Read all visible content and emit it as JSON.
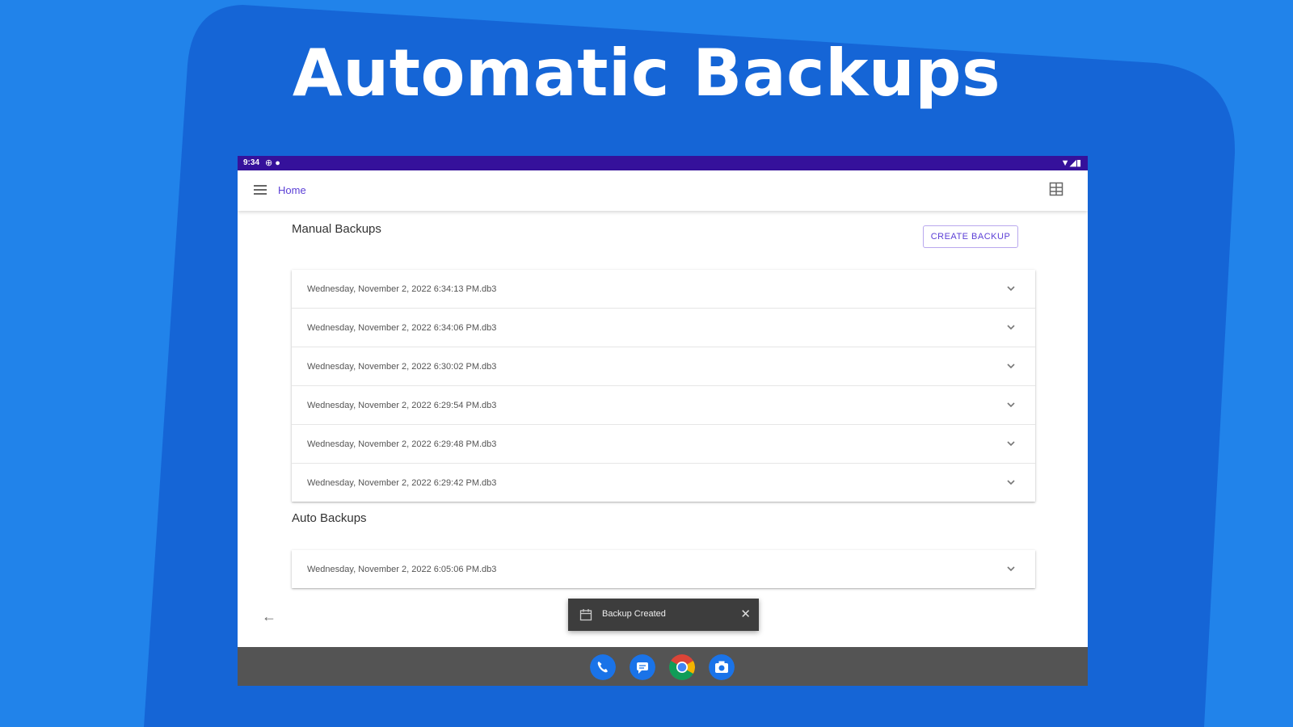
{
  "headline": "Automatic Backups",
  "status_bar": {
    "time": "9:34",
    "icons_left": "⊕ ●",
    "icons_right": "▼◢▮"
  },
  "app_bar": {
    "nav_label": "Home",
    "menu_icon": "menu-icon",
    "view_icon": "grid-view-icon"
  },
  "manual": {
    "title": "Manual Backups",
    "create_button": "CREATE BACKUP",
    "items": [
      "Wednesday, November 2, 2022 6:34:13 PM.db3",
      "Wednesday, November 2, 2022 6:34:06 PM.db3",
      "Wednesday, November 2, 2022 6:30:02 PM.db3",
      "Wednesday, November 2, 2022 6:29:54 PM.db3",
      "Wednesday, November 2, 2022 6:29:48 PM.db3",
      "Wednesday, November 2, 2022 6:29:42 PM.db3"
    ]
  },
  "auto": {
    "title": "Auto Backups",
    "items": [
      "Wednesday, November 2, 2022 6:05:06 PM.db3"
    ]
  },
  "toast": {
    "text": "Backup Created",
    "close": "✕"
  },
  "back_label": "←",
  "dock": [
    "phone-icon",
    "messages-icon",
    "chrome-icon",
    "camera-icon"
  ],
  "colors": {
    "background": "#2183ea",
    "shape": "#1565d6",
    "statusbar": "#35119b",
    "accent": "#5b3fd6"
  }
}
